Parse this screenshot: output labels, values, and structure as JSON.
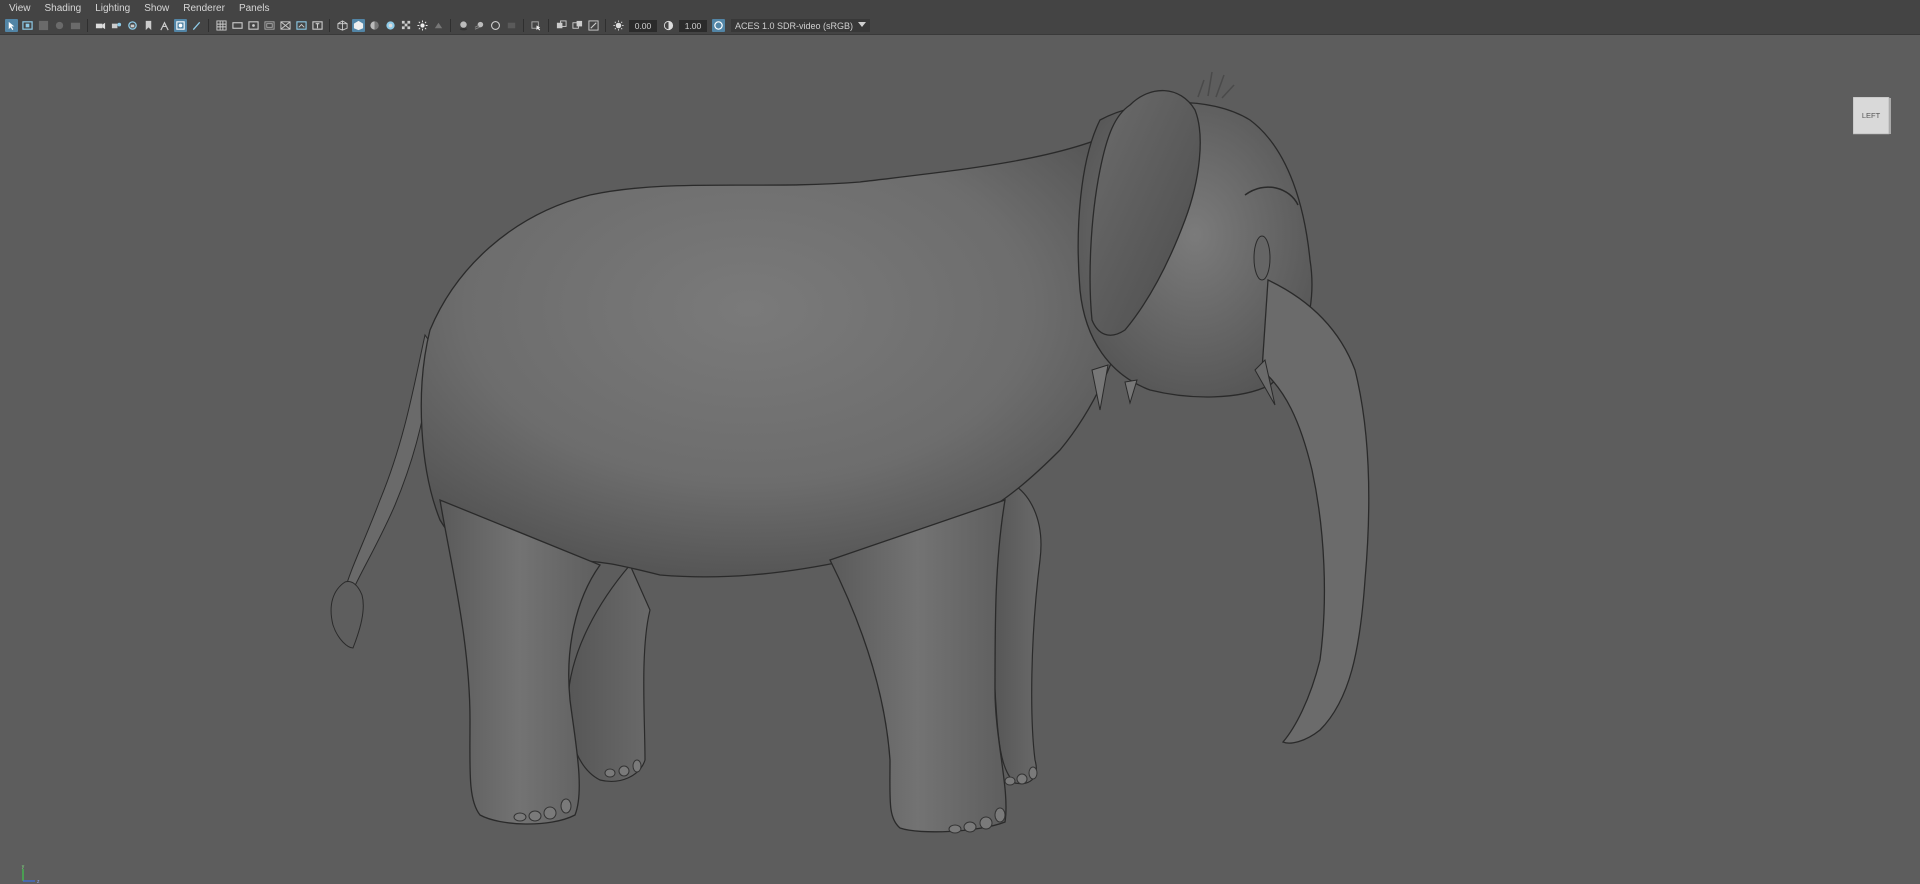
{
  "menu": {
    "items": [
      {
        "id": "view",
        "label": "View"
      },
      {
        "id": "shading",
        "label": "Shading"
      },
      {
        "id": "lighting",
        "label": "Lighting"
      },
      {
        "id": "show",
        "label": "Show"
      },
      {
        "id": "renderer",
        "label": "Renderer"
      },
      {
        "id": "panels",
        "label": "Panels"
      }
    ]
  },
  "toolbar": {
    "exposure_value": "0.00",
    "gamma_value": "1.00",
    "color_management": "ACES 1.0 SDR-video (sRGB)"
  },
  "viewcube": {
    "label": "LEFT"
  },
  "colors": {
    "panel_bg": "#444444",
    "viewport_bg": "#5d5d5d",
    "accent_active": "#5285a6"
  }
}
